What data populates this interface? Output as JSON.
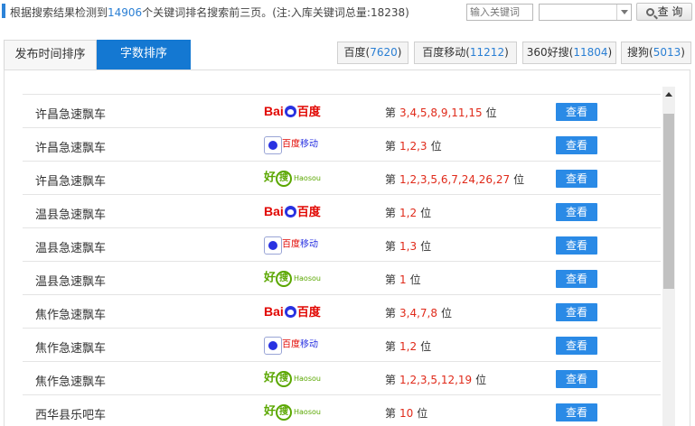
{
  "header": {
    "summary_prefix": "根据搜索结果检测到",
    "summary_count": "14906",
    "summary_suffix": "个关键词排名搜索前三页。(注:入库关键词总量:18238)",
    "keyword_placeholder": "输入关键词",
    "select_value": "",
    "query_label": "查 询"
  },
  "tabs": [
    {
      "label": "发布时间排序",
      "active": false
    },
    {
      "label": "字数排序",
      "active": true
    }
  ],
  "engines": [
    {
      "name": "百度",
      "count": "7620"
    },
    {
      "name": "百度移动",
      "count": "11212"
    },
    {
      "name": "360好搜",
      "count": "11804"
    },
    {
      "name": "搜狗",
      "count": "5013"
    }
  ],
  "logos": {
    "baidu": {
      "bai": "Bai",
      "du": "百度"
    },
    "baidu_mobile": {
      "t1": "百度",
      "t2": "移动"
    },
    "haosou": {
      "hao": "好",
      "sou": "搜",
      "sub": "Haosou"
    }
  },
  "rank": {
    "prefix": "第",
    "suffix": "位"
  },
  "view_label": "查看",
  "rows": [
    {
      "keyword": "许昌急速飘车",
      "engine": "baidu",
      "positions": "3,4,5,8,9,11,15"
    },
    {
      "keyword": "许昌急速飘车",
      "engine": "baidu_mobile",
      "positions": "1,2,3"
    },
    {
      "keyword": "许昌急速飘车",
      "engine": "haosou",
      "positions": "1,2,3,5,6,7,24,26,27"
    },
    {
      "keyword": "温县急速飘车",
      "engine": "baidu",
      "positions": "1,2"
    },
    {
      "keyword": "温县急速飘车",
      "engine": "baidu_mobile",
      "positions": "1,3"
    },
    {
      "keyword": "温县急速飘车",
      "engine": "haosou",
      "positions": "1"
    },
    {
      "keyword": "焦作急速飘车",
      "engine": "baidu",
      "positions": "3,4,7,8"
    },
    {
      "keyword": "焦作急速飘车",
      "engine": "baidu_mobile",
      "positions": "1,2"
    },
    {
      "keyword": "焦作急速飘车",
      "engine": "haosou",
      "positions": "1,2,3,5,12,19"
    },
    {
      "keyword": "西华县乐吧车",
      "engine": "haosou",
      "positions": "10"
    }
  ],
  "colors": {
    "accent": "#1478d2",
    "rank": "#e02a1a",
    "view_button": "#2a8ae6",
    "count": "#2a7fd4"
  }
}
